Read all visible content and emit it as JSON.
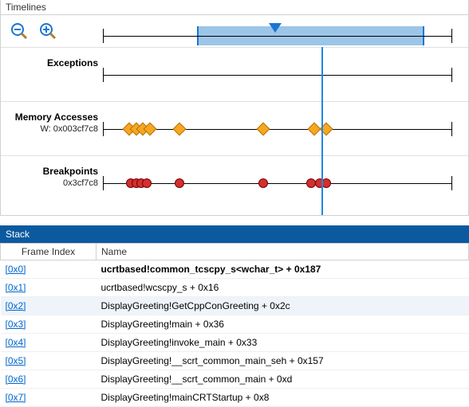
{
  "timelines": {
    "panel_title": "Timelines",
    "overview": {
      "selection_start_pct": 27,
      "selection_width_pct": 65,
      "playhead_pct": 34
    },
    "playhead_pct": 62.5,
    "rows": [
      {
        "title": "Exceptions",
        "sub": "",
        "markers": []
      },
      {
        "title": "Memory Accesses",
        "sub": "W: 0x003cf7c8",
        "marker_shape": "diamond",
        "markers_pct": [
          7.5,
          9.5,
          11.5,
          13.5,
          22,
          46,
          60.5,
          64
        ]
      },
      {
        "title": "Breakpoints",
        "sub": "0x3cf7c8",
        "marker_shape": "dot",
        "markers_pct": [
          8,
          9.5,
          11,
          12.5,
          22,
          46,
          59.5,
          62,
          64
        ]
      }
    ]
  },
  "stack": {
    "panel_title": "Stack",
    "columns": {
      "frame": "Frame Index",
      "name": "Name"
    },
    "frames": [
      {
        "idx": "[0x0]",
        "name": "ucrtbased!common_tcscpy_s<wchar_t> + 0x187",
        "current": true
      },
      {
        "idx": "[0x1]",
        "name": "ucrtbased!wcscpy_s + 0x16"
      },
      {
        "idx": "[0x2]",
        "name": "DisplayGreeting!GetCppConGreeting + 0x2c",
        "selected": true
      },
      {
        "idx": "[0x3]",
        "name": "DisplayGreeting!main + 0x36"
      },
      {
        "idx": "[0x4]",
        "name": "DisplayGreeting!invoke_main + 0x33"
      },
      {
        "idx": "[0x5]",
        "name": "DisplayGreeting!__scrt_common_main_seh + 0x157"
      },
      {
        "idx": "[0x6]",
        "name": "DisplayGreeting!__scrt_common_main + 0xd"
      },
      {
        "idx": "[0x7]",
        "name": "DisplayGreeting!mainCRTStartup + 0x8"
      }
    ]
  }
}
